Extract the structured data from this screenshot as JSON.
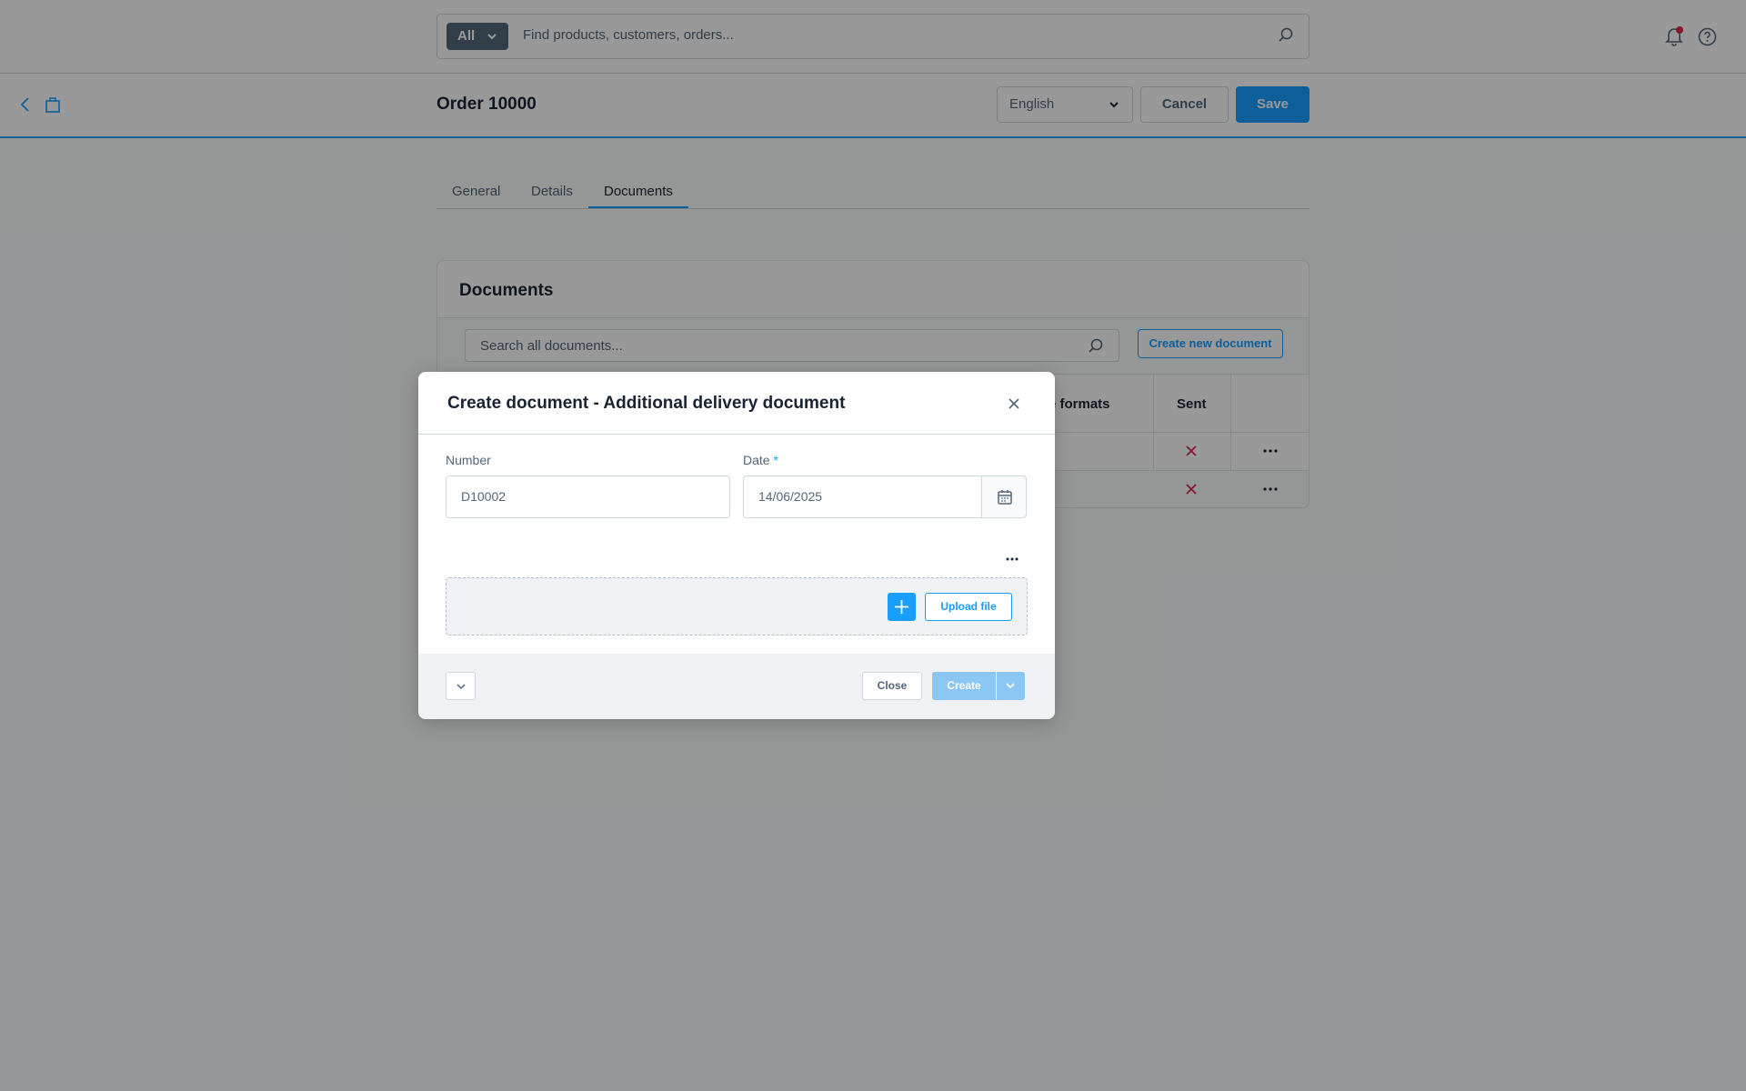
{
  "topbar": {
    "search_type": "All",
    "search_placeholder": "Find products, customers, orders..."
  },
  "smartbar": {
    "title": "Order 10000",
    "language": "English",
    "cancel_label": "Cancel",
    "save_label": "Save"
  },
  "tabs": [
    {
      "label": "General",
      "active": false
    },
    {
      "label": "Details",
      "active": false
    },
    {
      "label": "Documents",
      "active": true
    }
  ],
  "documents_card": {
    "title": "Documents",
    "search_placeholder": "Search all documents...",
    "create_button": "Create new document",
    "columns": {
      "formats": "e formats",
      "sent": "Sent"
    },
    "rows": [
      {
        "sent": false
      },
      {
        "sent": false
      }
    ]
  },
  "modal": {
    "title": "Create document - Additional delivery document",
    "number_label": "Number",
    "number_value": "D10002",
    "date_label": "Date",
    "date_required": "*",
    "date_value": "14/06/2025",
    "upload_label": "Upload file",
    "close_label": "Close",
    "create_label": "Create"
  },
  "colors": {
    "accent": "#189eff",
    "error": "#de294c",
    "text": "#1a2333",
    "muted": "#52667a"
  },
  "icons": [
    "search-icon",
    "bell-icon",
    "help-icon",
    "back-icon",
    "module-icon",
    "chevron-down-icon",
    "close-icon",
    "calendar-icon",
    "plus-icon",
    "more-icon",
    "x-mark-icon"
  ]
}
